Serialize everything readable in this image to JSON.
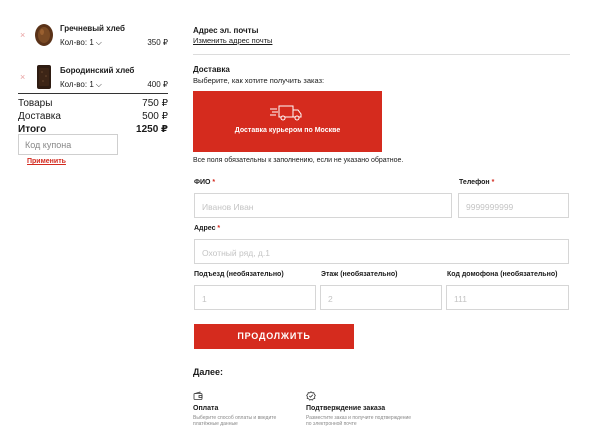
{
  "cart": {
    "items": [
      {
        "name": "Гречневый хлеб",
        "qty_label": "Кол-во: 1",
        "price": "350 ₽",
        "remove": "×"
      },
      {
        "name": "Бородинский хлеб",
        "qty_label": "Кол-во: 1",
        "price": "400 ₽",
        "remove": "×"
      }
    ],
    "totals": {
      "goods_label": "Товары",
      "goods_value": "750 ₽",
      "delivery_label": "Доставка",
      "delivery_value": "500 ₽",
      "total_label": "Итого",
      "total_value": "1250 ₽"
    },
    "coupon_placeholder": "Код купона",
    "apply_label": "Применить"
  },
  "email": {
    "title": "Адрес эл. почты",
    "change_link": "Изменить адрес почты"
  },
  "delivery": {
    "title": "Доставка",
    "subtitle": "Выберите, как хотите получить заказ:",
    "option_label": "Доставка курьером по Москве",
    "option_icon": "truck-icon"
  },
  "form": {
    "required_note": "Все поля обязательны к заполнению, если не указано обратное.",
    "name": {
      "label": "ФИО",
      "required": "*",
      "placeholder": "Иванов Иван"
    },
    "phone": {
      "label": "Телефон",
      "required": "*",
      "placeholder": "9999999999"
    },
    "address": {
      "label": "Адрес",
      "required": "*",
      "placeholder": "Охотный ряд, д.1"
    },
    "entrance": {
      "label": "Подъезд (необязательно)",
      "placeholder": "1"
    },
    "floor": {
      "label": "Этаж (необязательно)",
      "placeholder": "2"
    },
    "intercom": {
      "label": "Код домофона (необязательно)",
      "placeholder": "111"
    },
    "continue_label": "ПРОДОЛЖИТЬ"
  },
  "next": {
    "title": "Далее:",
    "steps": [
      {
        "icon": "wallet-icon",
        "title": "Оплата",
        "desc": "Выберите способ оплаты и введите платёжные данные"
      },
      {
        "icon": "verified-icon",
        "title": "Подтверждение заказа",
        "desc": "Разместите заказ и получите подтверждение по электронной почте"
      }
    ]
  },
  "colors": {
    "accent": "#d52b1e"
  }
}
